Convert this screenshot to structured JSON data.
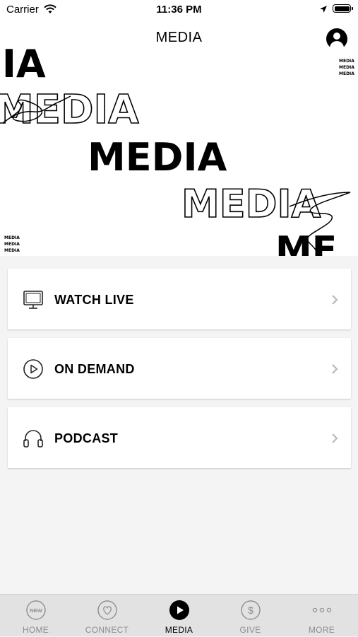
{
  "status_bar": {
    "carrier": "Carrier",
    "time": "11:36 PM"
  },
  "nav": {
    "title": "MEDIA"
  },
  "hero": {
    "words": [
      "DIA",
      "MEDIA",
      "MEDIA",
      "MEDIA",
      "ME"
    ],
    "small_stack": [
      "MEDIA",
      "MEDIA",
      "MEDIA"
    ]
  },
  "menu": {
    "items": [
      {
        "label": "WATCH LIVE",
        "icon": "monitor-icon"
      },
      {
        "label": "ON DEMAND",
        "icon": "play-circle-icon"
      },
      {
        "label": "PODCAST",
        "icon": "headphones-icon"
      }
    ]
  },
  "tabs": {
    "items": [
      {
        "label": "HOME",
        "icon": "new-badge-icon",
        "badge_text": "NEW"
      },
      {
        "label": "CONNECT",
        "icon": "heart-circle-icon"
      },
      {
        "label": "MEDIA",
        "icon": "play-circle-icon"
      },
      {
        "label": "GIVE",
        "icon": "dollar-circle-icon",
        "symbol": "$"
      },
      {
        "label": "MORE",
        "icon": "more-dots-icon"
      }
    ],
    "active_label": "MEDIA"
  },
  "colors": {
    "active": "#000000",
    "inactive": "#8e8e8e",
    "tab_bar_bg": "#e2e2e2",
    "page_bg": "#f4f4f4"
  }
}
